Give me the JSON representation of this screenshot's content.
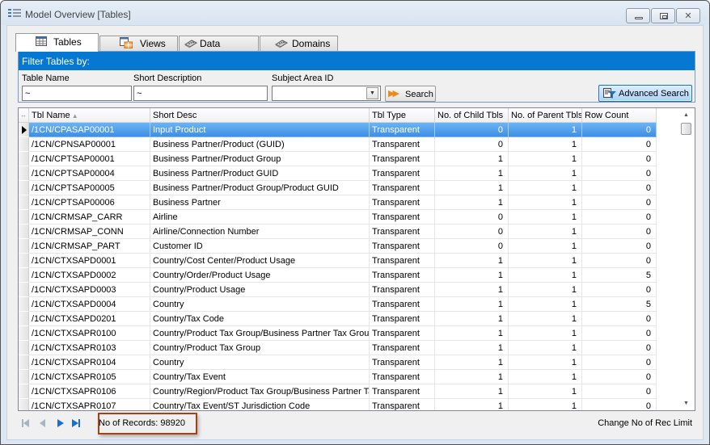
{
  "window": {
    "title": "Model Overview [Tables]",
    "minimize_label": "minimize",
    "maximize_label": "maximize",
    "close_glyph": "✕"
  },
  "tabs": [
    {
      "label": "Tables",
      "icon": "table-grid-icon",
      "active": true
    },
    {
      "label": "Views",
      "icon": "view-grid-icon",
      "active": false
    },
    {
      "label": "Data Elements",
      "icon": "data-element-icon",
      "active": false
    },
    {
      "label": "Domains",
      "icon": "domain-icon",
      "active": false
    }
  ],
  "filter": {
    "header": "Filter Tables by:",
    "table_name_label": "Table Name",
    "table_name_value": "~",
    "short_desc_label": "Short Description",
    "short_desc_value": "~",
    "subject_area_label": "Subject Area ID",
    "subject_area_value": "",
    "search_label": "Search",
    "advanced_search_label": "Advanced Search"
  },
  "grid": {
    "columns": [
      "Tbl Name",
      "Short Desc",
      "Tbl Type",
      "No. of Child Tbls",
      "No. of Parent Tbls",
      "Row Count"
    ],
    "sort_column": "Tbl Name",
    "sort_direction": "ascending",
    "selected_row": 0,
    "rows": [
      [
        "/1CN/CPASAP00001",
        "Input Product",
        "Transparent",
        "0",
        "1",
        "0"
      ],
      [
        "/1CN/CPNSAP00001",
        "Business Partner/Product (GUID)",
        "Transparent",
        "0",
        "1",
        "0"
      ],
      [
        "/1CN/CPTSAP00001",
        "Business Partner/Product Group",
        "Transparent",
        "1",
        "1",
        "0"
      ],
      [
        "/1CN/CPTSAP00004",
        "Business Partner/Product GUID",
        "Transparent",
        "1",
        "1",
        "0"
      ],
      [
        "/1CN/CPTSAP00005",
        "Business Partner/Product Group/Product GUID",
        "Transparent",
        "1",
        "1",
        "0"
      ],
      [
        "/1CN/CPTSAP00006",
        "Business Partner",
        "Transparent",
        "1",
        "1",
        "0"
      ],
      [
        "/1CN/CRMSAP_CARR",
        "Airline",
        "Transparent",
        "0",
        "1",
        "0"
      ],
      [
        "/1CN/CRMSAP_CONN",
        "Airline/Connection Number",
        "Transparent",
        "0",
        "1",
        "0"
      ],
      [
        "/1CN/CRMSAP_PART",
        "Customer ID",
        "Transparent",
        "0",
        "1",
        "0"
      ],
      [
        "/1CN/CTXSAPD0001",
        "Country/Cost Center/Product Usage",
        "Transparent",
        "1",
        "1",
        "0"
      ],
      [
        "/1CN/CTXSAPD0002",
        "Country/Order/Product Usage",
        "Transparent",
        "1",
        "1",
        "5"
      ],
      [
        "/1CN/CTXSAPD0003",
        "Country/Product Usage",
        "Transparent",
        "1",
        "1",
        "0"
      ],
      [
        "/1CN/CTXSAPD0004",
        "Country",
        "Transparent",
        "1",
        "1",
        "5"
      ],
      [
        "/1CN/CTXSAPD0201",
        "Country/Tax Code",
        "Transparent",
        "1",
        "1",
        "0"
      ],
      [
        "/1CN/CTXSAPR0100",
        "Country/Product Tax Group/Business Partner Tax Group",
        "Transparent",
        "1",
        "1",
        "0"
      ],
      [
        "/1CN/CTXSAPR0103",
        "Country/Product Tax Group",
        "Transparent",
        "1",
        "1",
        "0"
      ],
      [
        "/1CN/CTXSAPR0104",
        "Country",
        "Transparent",
        "1",
        "1",
        "0"
      ],
      [
        "/1CN/CTXSAPR0105",
        "Country/Tax Event",
        "Transparent",
        "1",
        "1",
        "0"
      ],
      [
        "/1CN/CTXSAPR0106",
        "Country/Region/Product Tax Group/Business Partner Tax",
        "Transparent",
        "1",
        "1",
        "0"
      ],
      [
        "/1CN/CTXSAPR0107",
        "Country/Tax Event/ST Jurisdiction Code",
        "Transparent",
        "1",
        "1",
        "0"
      ]
    ]
  },
  "footer": {
    "records_text": "No of Records: 98920",
    "rec_limit_link": "Change No of Rec Limit"
  },
  "colors": {
    "header_blue": "#0678d1",
    "selection_blue": "#3d8fe6",
    "highlight_box": "#a0421a",
    "search_arrow": "#e98b1a"
  }
}
